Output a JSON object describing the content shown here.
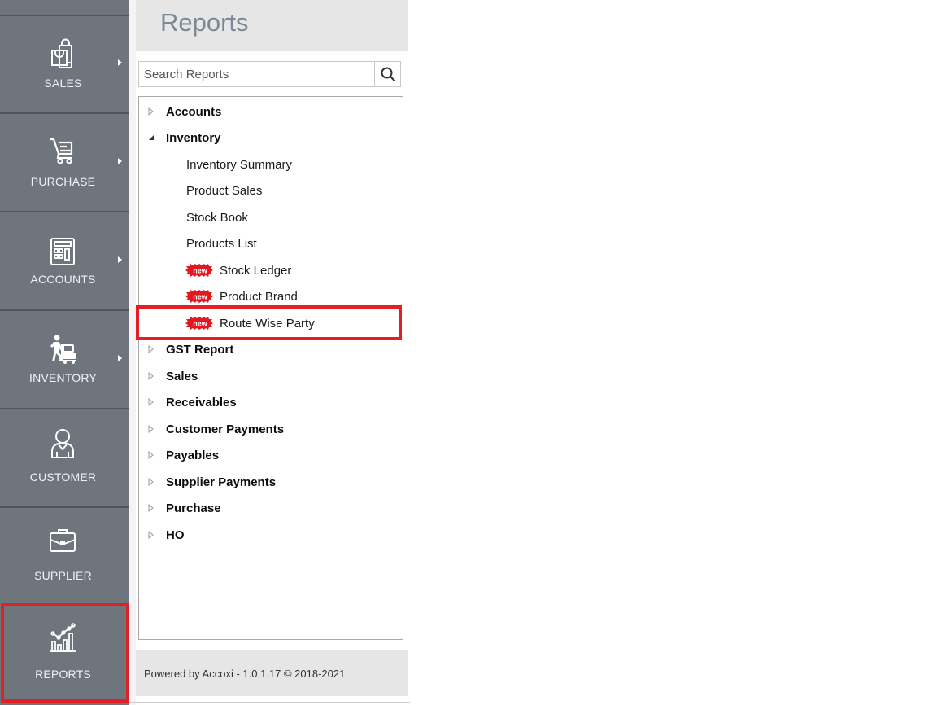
{
  "sidebar": {
    "items": [
      {
        "label": "SALES",
        "icon": "shopping-bag-icon",
        "has_submenu": true
      },
      {
        "label": "PURCHASE",
        "icon": "shopping-cart-icon",
        "has_submenu": true
      },
      {
        "label": "ACCOUNTS",
        "icon": "calculator-icon",
        "has_submenu": true
      },
      {
        "label": "INVENTORY",
        "icon": "hand-truck-icon",
        "has_submenu": true
      },
      {
        "label": "CUSTOMER",
        "icon": "user-icon",
        "has_submenu": false
      },
      {
        "label": "SUPPLIER",
        "icon": "briefcase-icon",
        "has_submenu": false
      },
      {
        "label": "REPORTS",
        "icon": "chart-icon",
        "has_submenu": false,
        "selected": true
      }
    ]
  },
  "reports": {
    "title": "Reports",
    "search": {
      "placeholder": "Search Reports",
      "value": ""
    },
    "tree": [
      {
        "label": "Accounts",
        "expanded": false
      },
      {
        "label": "Inventory",
        "expanded": true,
        "children": [
          {
            "label": "Inventory Summary",
            "is_new": false
          },
          {
            "label": "Product Sales",
            "is_new": false
          },
          {
            "label": "Stock Book",
            "is_new": false
          },
          {
            "label": "Products List",
            "is_new": false
          },
          {
            "label": "Stock Ledger",
            "is_new": true
          },
          {
            "label": "Product Brand",
            "is_new": true
          },
          {
            "label": "Route Wise Party",
            "is_new": true,
            "highlighted": true
          }
        ]
      },
      {
        "label": "GST Report",
        "expanded": false
      },
      {
        "label": "Sales",
        "expanded": false
      },
      {
        "label": "Receivables",
        "expanded": false
      },
      {
        "label": "Customer Payments",
        "expanded": false
      },
      {
        "label": "Payables",
        "expanded": false
      },
      {
        "label": "Supplier Payments",
        "expanded": false
      },
      {
        "label": "Purchase",
        "expanded": false
      },
      {
        "label": "HO",
        "expanded": false
      }
    ],
    "new_badge_text": "new",
    "footer": "Powered by Accoxi - 1.0.1.17 © 2018-2021"
  },
  "colors": {
    "sidebar_bg": "#6e757c",
    "highlight": "#e31e24",
    "badge": "#e2181f",
    "header_bg": "#e6e6e6",
    "title_text": "#7b8996"
  }
}
